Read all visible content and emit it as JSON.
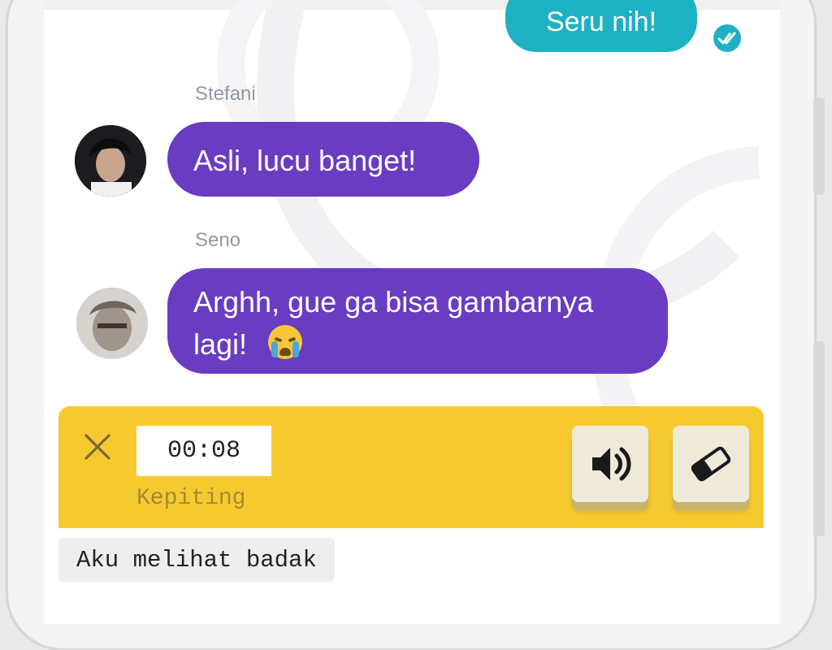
{
  "colors": {
    "outgoing_bubble": "#1eb1c4",
    "incoming_bubble": "#6a3cc2",
    "recorder_bar": "#f6c92f",
    "read_check": "#1eb1c4"
  },
  "chat": {
    "outgoing": {
      "text": "Seru nih!",
      "status_icon": "double-check-icon"
    },
    "incoming": [
      {
        "sender": "Stefani",
        "text": "Asli, lucu banget!",
        "avatar_icon": "avatar-stefani"
      },
      {
        "sender": "Seno",
        "text_line1": "Arghh, gue ga bisa gambarnya",
        "text_line2": "lagi!",
        "emoji": "crying-face-emoji",
        "avatar_icon": "avatar-seno"
      }
    ]
  },
  "recorder": {
    "close_icon": "close-icon",
    "timer": "00:08",
    "label": "Kepiting",
    "buttons": [
      {
        "name": "speaker-button",
        "icon": "speaker-icon"
      },
      {
        "name": "eraser-button",
        "icon": "eraser-icon"
      }
    ]
  },
  "composer": {
    "text": "Aku melihat badak"
  }
}
